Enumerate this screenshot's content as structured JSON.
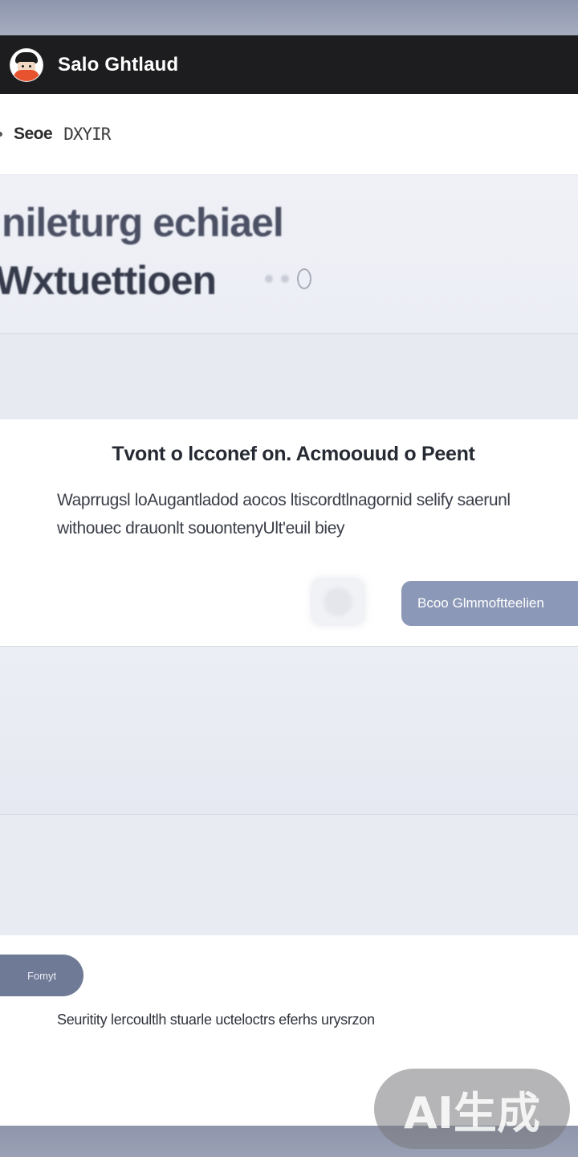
{
  "header": {
    "title": "Salo Ghtlaud"
  },
  "subheader": {
    "label": "Seoe",
    "label2": "DXYIR"
  },
  "hero": {
    "line1": "nileturg echiael",
    "line2": "Wxtuettioen"
  },
  "card": {
    "title": "Tvont o lcconef on. Acmoouud o Peent",
    "body": "Waprrugsl loAugantladod aocos ltiscordtlnagornid selify saerunl withouec drauonlt souontenyUlt'euil biey",
    "primary_button_label": "Bcoo Glmmoftteelien"
  },
  "bottom": {
    "pill_button_label": "Fomyt",
    "note": "Seuritity lercoultlh stuarle ucteloctrs eferhs urysrzon"
  },
  "watermark": {
    "text": "AI生成"
  },
  "colors": {
    "header_bg": "#1d1d1f",
    "primary_button": "#8c98b7",
    "pill_button": "#6e7a96",
    "band": "#e9ebf3"
  }
}
